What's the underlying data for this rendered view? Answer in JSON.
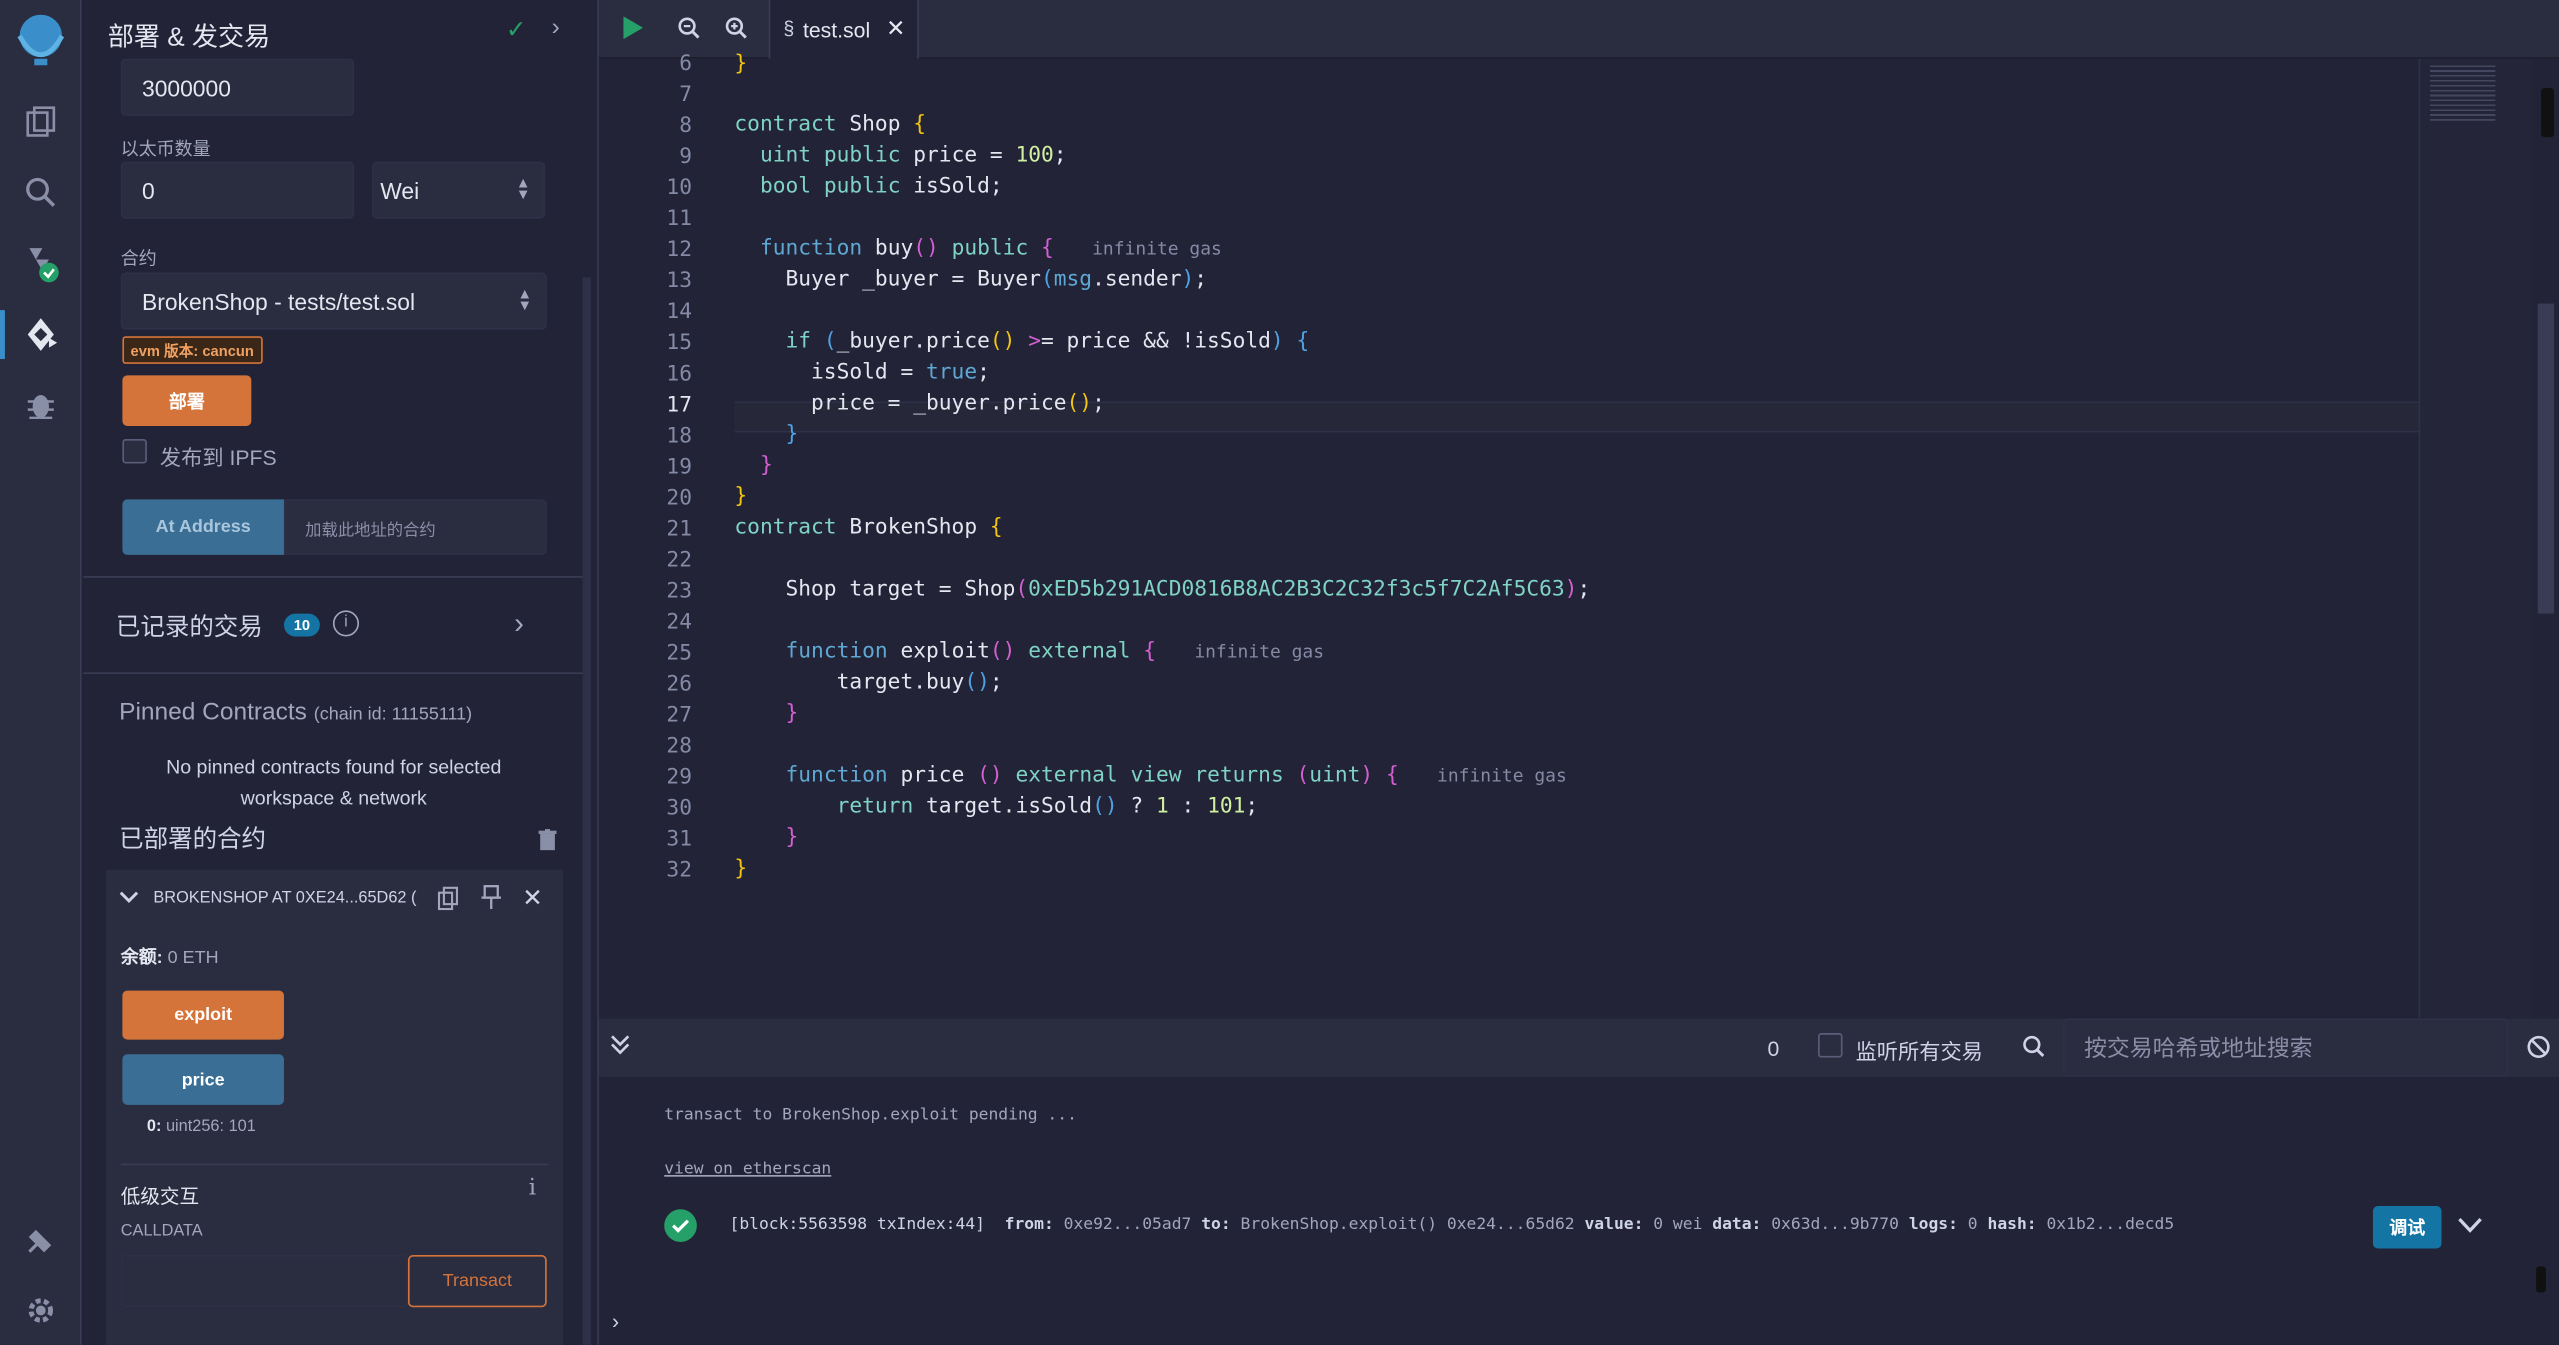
{
  "panel": {
    "title": "部署 & 发交易",
    "gas_limit_value": "3000000",
    "value_label": "以太币数量",
    "value_amount": "0",
    "value_unit": "Wei",
    "contract_label": "合约",
    "contract_selected": "BrokenShop - tests/test.sol",
    "evm_badge": "evm 版本: cancun",
    "deploy_button": "部署",
    "publish_ipfs": "发布到 IPFS",
    "at_address_button": "At Address",
    "at_address_placeholder": "加载此地址的合约",
    "recorded_tx_label": "已记录的交易",
    "recorded_tx_count": "10",
    "pinned_title": "Pinned Contracts",
    "pinned_chain": "(chain id: 11155111)",
    "pinned_empty_1": "No pinned contracts found for selected",
    "pinned_empty_2": "workspace & network",
    "deployed_title": "已部署的合约",
    "instance_title": "BROKENSHOP AT 0XE24...65D62 (",
    "balance_label": "余额:",
    "balance_value": "0 ETH",
    "exploit_button": "exploit",
    "price_button": "price",
    "price_result_key": "0:",
    "price_result_value": "uint256: 101",
    "low_level_title": "低级交互",
    "calldata_label": "CALLDATA",
    "transact_button": "Transact"
  },
  "tab": {
    "file_name": "test.sol"
  },
  "editor": {
    "line_numbers": [
      "6",
      "7",
      "8",
      "9",
      "10",
      "11",
      "12",
      "13",
      "14",
      "15",
      "16",
      "17",
      "18",
      "19",
      "20",
      "21",
      "22",
      "23",
      "24",
      "25",
      "26",
      "27",
      "28",
      "29",
      "30",
      "31",
      "32"
    ],
    "gas_label": "infinite gas"
  },
  "terminal": {
    "tx_count": "0",
    "listen_label": "监听所有交易",
    "search_placeholder": "按交易哈希或地址搜索",
    "line_pending": "transact to BrokenShop.exploit pending ...",
    "line_etherscan": "view on etherscan",
    "tx_block": "[block:5563598 txIndex:44]",
    "from_key": "from:",
    "from_val": "0xe92...05ad7",
    "to_key": "to:",
    "to_val": "BrokenShop.exploit() 0xe24...65d62",
    "value_key": "value:",
    "value_val": "0 wei",
    "data_key": "data:",
    "data_val": "0x63d...9b770",
    "logs_key": "logs:",
    "logs_val": "0",
    "hash_key": "hash:",
    "hash_val": "0x1b2...decd5",
    "debug_button": "调试"
  },
  "colors": {
    "accent_orange": "#d5743a",
    "accent_blue": "#3a6e94",
    "success_green": "#26a069",
    "debug_blue": "#1474a4"
  }
}
